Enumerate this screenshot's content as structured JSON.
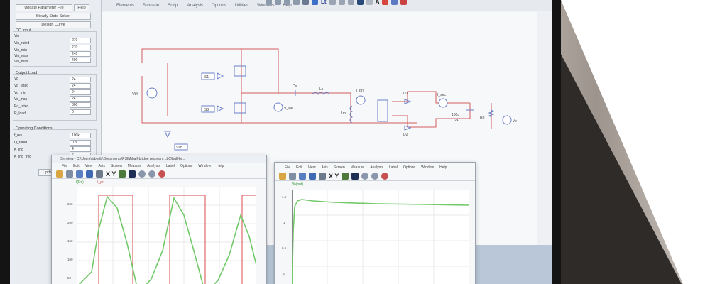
{
  "menubar": {
    "items": [
      "Elements",
      "Simulate",
      "Script",
      "Analysis",
      "Options",
      "Utilities",
      "Windows",
      "Help"
    ],
    "toolbar_letters": [
      "Lt",
      "A"
    ]
  },
  "left_panel": {
    "update_button": "Update Parameter File",
    "help_button": "Help",
    "steady_button": "Steady State Solver",
    "design_button": "Design Curve",
    "dc_input": {
      "title": "DC Input",
      "rows": [
        {
          "label": "Vin",
          "value": ""
        },
        {
          "label": "Vin_rated",
          "value": "270"
        },
        {
          "label": "Vin_min",
          "value": "270"
        },
        {
          "label": "Vin_max",
          "value": "240"
        },
        {
          "label": "Vin_max",
          "value": "400"
        }
      ]
    },
    "output_load": {
      "title": "Output Load",
      "rows": [
        {
          "label": "Vo",
          "value": "24"
        },
        {
          "label": "Vo_rated",
          "value": "24"
        },
        {
          "label": "Vo_min",
          "value": "24"
        },
        {
          "label": "Vo_max",
          "value": "24"
        },
        {
          "label": "Po_rated",
          "value": "300"
        },
        {
          "label": "R_load",
          "value": "0"
        }
      ]
    },
    "operating": {
      "title": "Operating Conditions",
      "rows": [
        {
          "label": "f_res",
          "value": "100k"
        },
        {
          "label": "Q_rated",
          "value": "0.3"
        },
        {
          "label": "K_ind",
          "value": "4"
        },
        {
          "label": "K_ind_freq",
          "value": "6"
        }
      ]
    },
    "bottom_button": "Update"
  },
  "schematic": {
    "labels": {
      "vin": "Vin",
      "s1": "S1",
      "s3": "S3",
      "vsw": "V_sw",
      "cs": "Cs",
      "ls": "Ls",
      "lm": "Lm",
      "ipri": "I_pri",
      "d1": "D1",
      "d2": "D2",
      "isec": "I_sec",
      "cap": "100u",
      "cap_v": "24",
      "ro": "Ro",
      "vo": "Vo",
      "vsn": "Vsn"
    }
  },
  "simview_left": {
    "title": "Simview - C:\\Users\\albertb\\Documents\\PSIM\\half-bridge resonant LLC\\half-br...",
    "menu": [
      "File",
      "Edit",
      "View",
      "Axis",
      "Screen",
      "Measure",
      "Analysis",
      "Label",
      "Options",
      "Window",
      "Help"
    ],
    "tool_letters": "X Y",
    "series": [
      "I(Ds)",
      "I_pri"
    ],
    "yticks": [
      "250",
      "200",
      "150",
      "100",
      "50"
    ],
    "colors": {
      "green": "#72c96a",
      "red": "#e06a6a"
    }
  },
  "simview_right": {
    "menu": [
      "File",
      "Edit",
      "View",
      "Axis",
      "Screen",
      "Measure",
      "Analysis",
      "Label",
      "Options",
      "Window",
      "Help"
    ],
    "tool_letters": "X Y",
    "series": [
      "Vo(out)"
    ],
    "yticks": [
      "1.5",
      "1",
      "0.5",
      "0"
    ],
    "colors": {
      "green": "#72c96a"
    }
  }
}
